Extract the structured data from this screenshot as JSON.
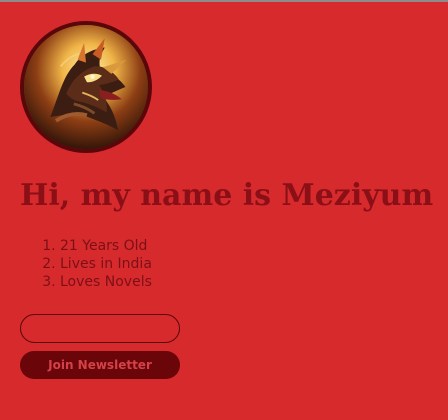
{
  "profile": {
    "avatar_icon": "dragon-avatar-image",
    "headline": "Hi, my name is Meziyum",
    "facts": [
      "21 Years Old",
      "Lives in India",
      "Loves Novels"
    ]
  },
  "newsletter": {
    "input_value": "",
    "input_placeholder": "",
    "button_label": "Join Newsletter"
  },
  "colors": {
    "background": "#d62a2d",
    "accent": "#7a0c10",
    "button": "#6a0509"
  }
}
